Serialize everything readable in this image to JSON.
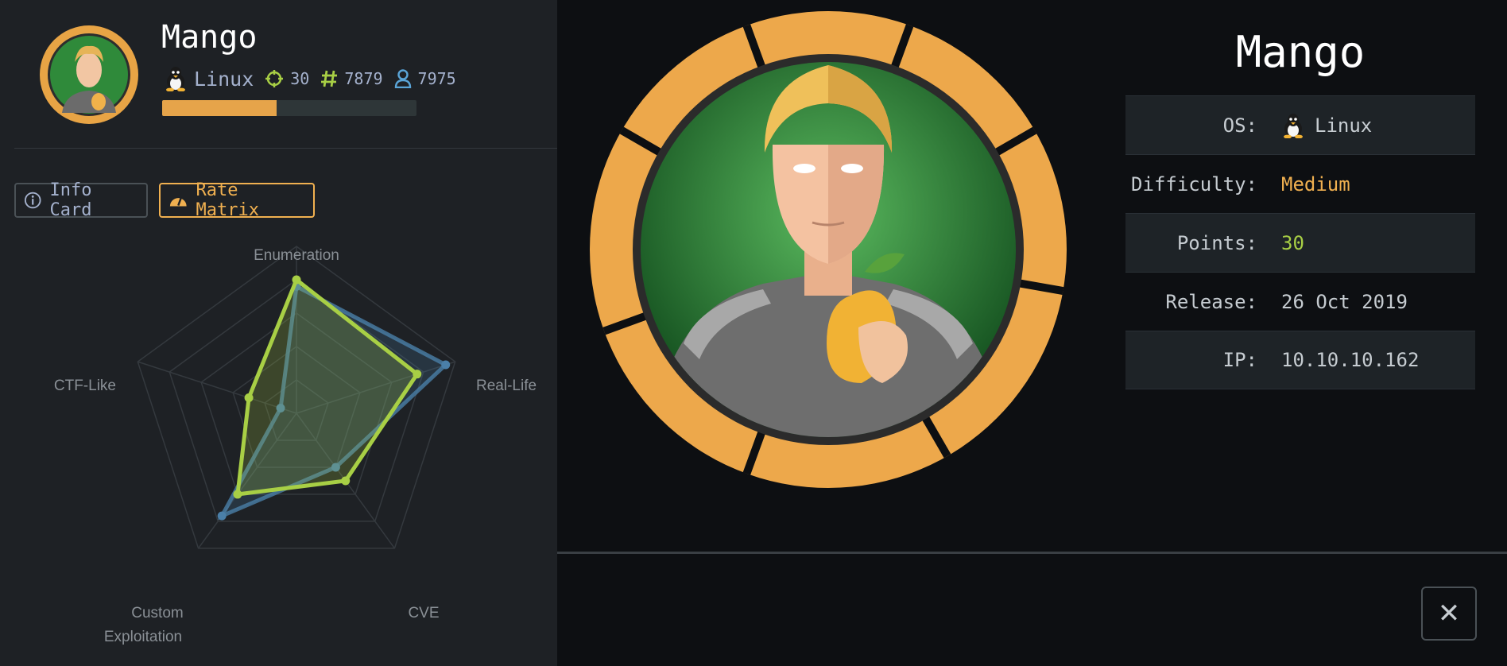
{
  "machine": {
    "name": "Mango",
    "os": "Linux",
    "points": "30",
    "user_owns": "7879",
    "root_owns": "7975",
    "progress": 0.45
  },
  "tabs": {
    "info_card": "Info Card",
    "rate_matrix": "Rate Matrix"
  },
  "radar": {
    "axes": [
      "Enumeration",
      "Real-Life",
      "CVE",
      "Custom",
      "Exploitation",
      "CTF-Like"
    ]
  },
  "chart_data": {
    "type": "radar",
    "axes": [
      "Enumeration",
      "Real-Life",
      "CVE",
      "Custom Exploitation",
      "CTF-Like"
    ],
    "max": 5,
    "series": [
      {
        "values": [
          3.8,
          4.7,
          2.0,
          3.8,
          0.5
        ],
        "color": "#4a7fa8"
      },
      {
        "values": [
          4.0,
          3.8,
          2.5,
          3.0,
          1.5
        ],
        "color": "#a8cf45"
      }
    ]
  },
  "info": {
    "title": "Mango",
    "rows": [
      {
        "label": "OS:",
        "value": "Linux"
      },
      {
        "label": "Difficulty:",
        "value": "Medium"
      },
      {
        "label": "Points:",
        "value": "30"
      },
      {
        "label": "Release:",
        "value": "26 Oct 2019"
      },
      {
        "label": "IP:",
        "value": "10.10.10.162"
      }
    ]
  },
  "close": "✕",
  "colors": {
    "accent": "#f0b050",
    "points": "#a8cf45",
    "series_user": "#4a7fa8",
    "series_machine": "#a8cf45"
  }
}
